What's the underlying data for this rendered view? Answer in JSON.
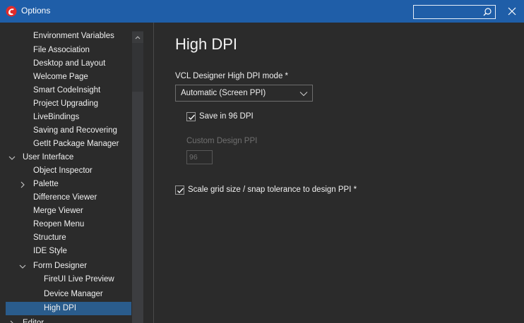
{
  "window": {
    "title": "Options",
    "search": {
      "value": "",
      "placeholder": ""
    }
  },
  "sidebar": {
    "items": [
      {
        "label": "Environment Variables"
      },
      {
        "label": "File Association"
      },
      {
        "label": "Desktop and Layout"
      },
      {
        "label": "Welcome Page"
      },
      {
        "label": "Smart CodeInsight"
      },
      {
        "label": "Project Upgrading"
      },
      {
        "label": "LiveBindings"
      },
      {
        "label": "Saving and Recovering"
      },
      {
        "label": "GetIt Package Manager"
      },
      {
        "label": "User Interface",
        "expanded": true
      },
      {
        "label": "Object Inspector"
      },
      {
        "label": "Palette",
        "collapsed": true
      },
      {
        "label": "Difference Viewer"
      },
      {
        "label": "Merge Viewer"
      },
      {
        "label": "Reopen Menu"
      },
      {
        "label": "Structure"
      },
      {
        "label": "IDE Style"
      },
      {
        "label": "Form Designer",
        "expanded": true
      },
      {
        "label": "FireUI Live Preview"
      },
      {
        "label": "Device Manager"
      },
      {
        "label": "High DPI",
        "selected": true
      },
      {
        "label": "Editor",
        "collapsed": true
      }
    ]
  },
  "main": {
    "title": "High DPI",
    "mode_label": "VCL Designer High DPI mode *",
    "mode_value": "Automatic (Screen PPI)",
    "save_96_label": "Save in 96 DPI",
    "save_96_checked": true,
    "custom_ppi_label": "Custom Design PPI",
    "custom_ppi_value": "96",
    "scale_grid_label": "Scale grid size / snap tolerance to design PPI *",
    "scale_grid_checked": true
  },
  "colors": {
    "titlebar": "#1f5ea8",
    "background": "#2b2b2b",
    "selection": "#2a5c8c",
    "disabled_text": "#6f6f6f"
  }
}
